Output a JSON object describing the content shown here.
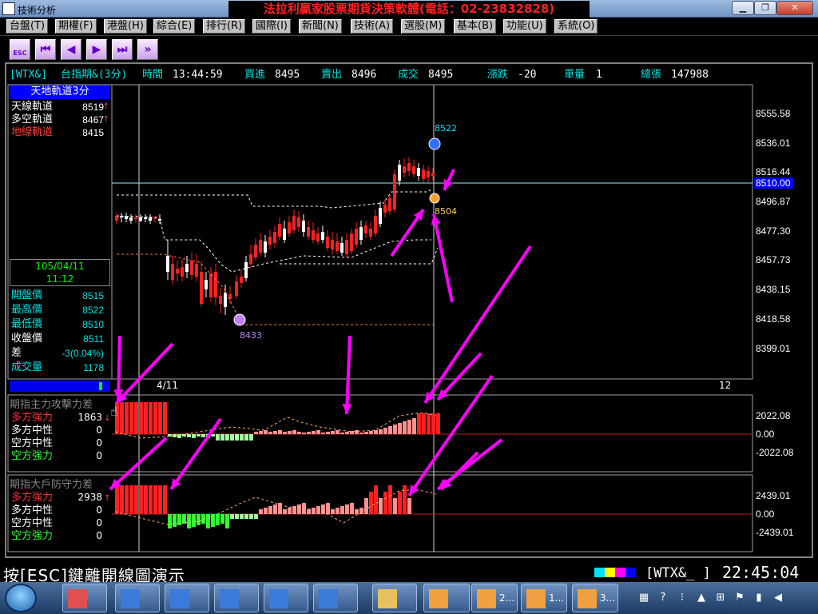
{
  "window": {
    "title": "技術分析",
    "banner": "法拉利贏家股票期貨決策軟體(電話：02-23832828)"
  },
  "menu": [
    "台盤(T)",
    "期權(F)",
    "港盤(H)",
    "綜合(E)",
    "排行(R)",
    "國際(I)",
    "新聞(N)",
    "技術(A)",
    "選股(M)",
    "基本(B)",
    "功能(U)",
    "系統(O)"
  ],
  "toolbar": {
    "esc_label": "ESC"
  },
  "quote": {
    "code": "[WTX&]",
    "name": "台指期&(3分)",
    "time_label": "時間",
    "time": "13:44:59",
    "bid_label": "買進",
    "bid": "8495",
    "ask_label": "賣出",
    "ask": "8496",
    "deal_label": "成交",
    "deal": "8495",
    "chg_label": "漲跌",
    "chg": "-20",
    "vol_label": "單量",
    "vol": "1",
    "total_label": "總張",
    "total": "147988"
  },
  "info": {
    "header": "天地軌道3分",
    "lines": [
      {
        "label": "天線軌道",
        "value": "8519",
        "arrow": "↑",
        "color": "#ffffff"
      },
      {
        "label": "多空軌道",
        "value": "8467",
        "arrow": "↑",
        "color": "#ffffff"
      },
      {
        "label": "地線軌道",
        "value": "8415",
        "arrow": "",
        "color": "#ff4040"
      }
    ],
    "date": "105/04/11",
    "time": "11:12",
    "ohlc": [
      {
        "label": "開盤價",
        "value": "8515",
        "color": "#00e0e0"
      },
      {
        "label": "最高價",
        "value": "8522",
        "color": "#00e0e0"
      },
      {
        "label": "最低價",
        "value": "8510",
        "color": "#00e0e0"
      },
      {
        "label": "收盤價",
        "value": "8511",
        "color": "#ffffff"
      },
      {
        "label": "差",
        "value": "-3(0.04%)",
        "color": "#ffffff"
      },
      {
        "label": "成交量",
        "value": "1178",
        "color": "#00e0e0"
      }
    ]
  },
  "price_axis": [
    "8555.58",
    "8536.01",
    "8516.44",
    "8510.00",
    "8496.87",
    "8477.30",
    "8457.73",
    "8438.15",
    "8418.58",
    "8399.01"
  ],
  "markers": {
    "high": "8522",
    "low": "8433",
    "last": "8504"
  },
  "time_axis": [
    "4/11",
    "12"
  ],
  "ind1": {
    "title": "期指主力攻擊力差",
    "rows": [
      {
        "label": "多方強力",
        "value": "1863",
        "arrow": "↓",
        "color": "#ff3030"
      },
      {
        "label": "多方中性",
        "value": "0",
        "arrow": "",
        "color": "#ffffff"
      },
      {
        "label": "空方中性",
        "value": "0",
        "arrow": "",
        "color": "#ffffff"
      },
      {
        "label": "空方強力",
        "value": "0",
        "arrow": "",
        "color": "#30ff30"
      }
    ],
    "axis": [
      "2022.08",
      "0.00",
      "-2022.08"
    ]
  },
  "ind2": {
    "title": "期指大戶防守力差",
    "rows": [
      {
        "label": "多方強力",
        "value": "2938",
        "arrow": "↑",
        "color": "#ff3030"
      },
      {
        "label": "多方中性",
        "value": "0",
        "arrow": "",
        "color": "#ffffff"
      },
      {
        "label": "空方中性",
        "value": "0",
        "arrow": "",
        "color": "#ffffff"
      },
      {
        "label": "空方強力",
        "value": "0",
        "arrow": "",
        "color": "#30ff30"
      }
    ],
    "axis": [
      "2439.01",
      "0.00",
      "-2439.01"
    ]
  },
  "status": {
    "text": "按[ESC]鍵離開線圖演示",
    "code": "[WTX&_   ]",
    "clock": "22:45:04"
  },
  "taskbar": [
    {
      "name": "app",
      "label": ""
    },
    {
      "name": "chart1",
      "label": ""
    },
    {
      "name": "chart2",
      "label": ""
    },
    {
      "name": "chart3",
      "label": ""
    },
    {
      "name": "chart4",
      "label": ""
    },
    {
      "name": "chart5",
      "label": ""
    },
    {
      "name": "folder",
      "label": ""
    },
    {
      "name": "win1",
      "label": ""
    },
    {
      "name": "win2",
      "label": "2..."
    },
    {
      "name": "win3",
      "label": "1..."
    },
    {
      "name": "win4",
      "label": "3..."
    }
  ],
  "colors": {
    "up": "#ff2020",
    "down": "#ffffff",
    "grid": "#a0a0a0",
    "arrow": "#ff00ff",
    "accent": "#00e0e0"
  }
}
